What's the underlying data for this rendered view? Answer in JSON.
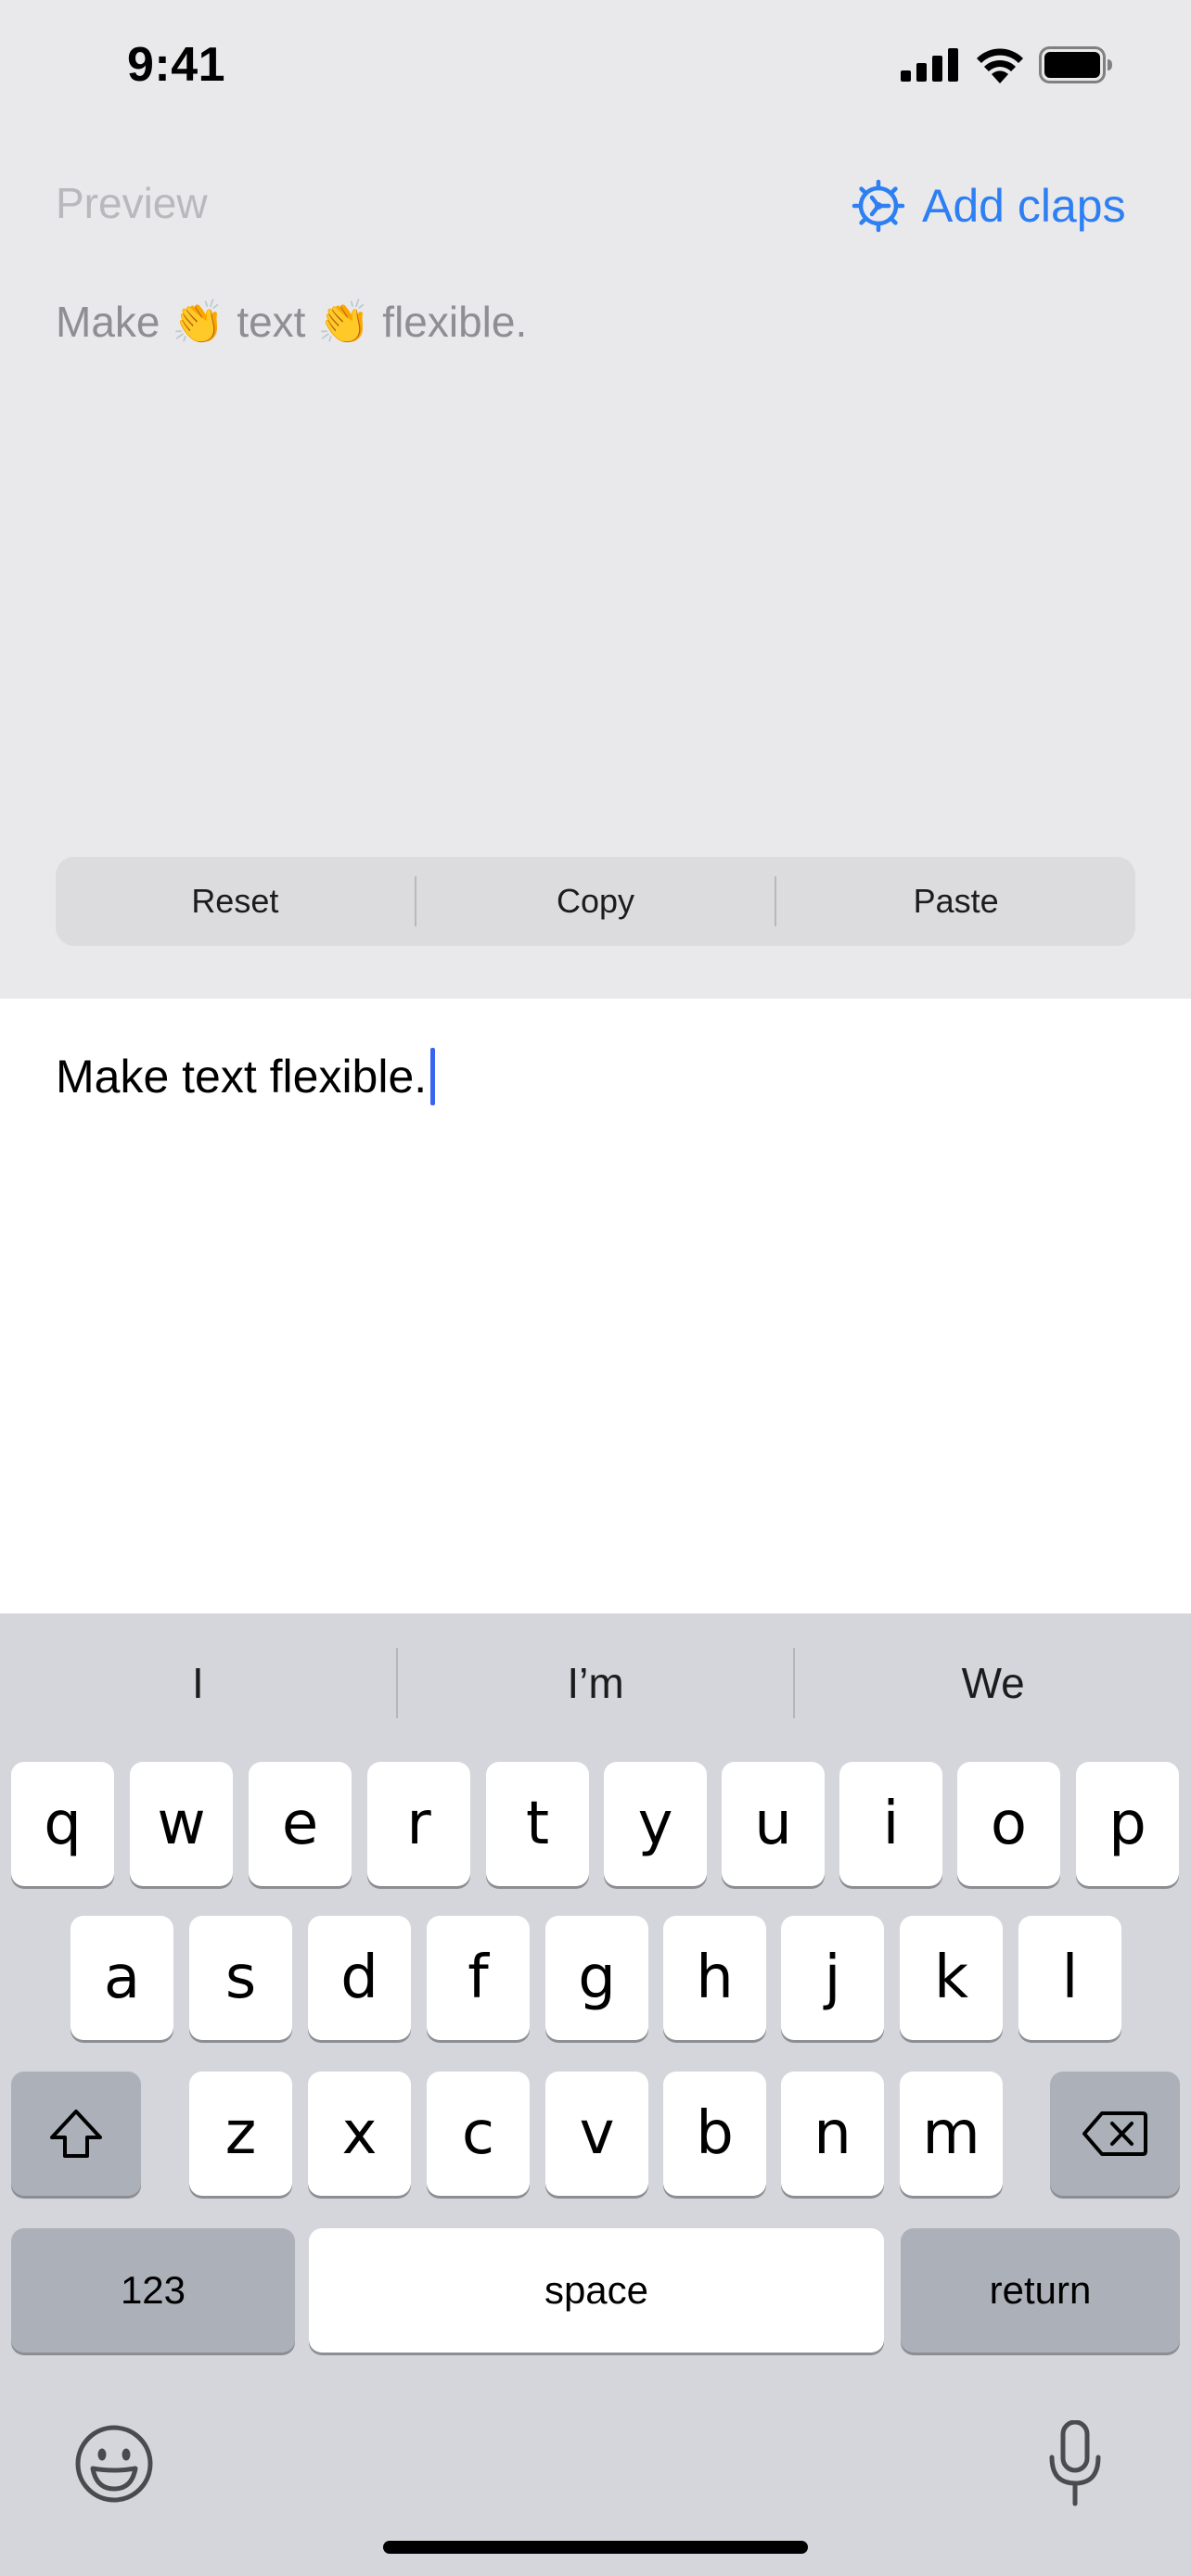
{
  "status_bar": {
    "time": "9:41"
  },
  "header": {
    "preview_label": "Preview",
    "add_claps_label": "Add claps",
    "accent_color": "#2d7ff3"
  },
  "preview": {
    "text": "Make 👏 text 👏 flexible."
  },
  "actions": {
    "reset_label": "Reset",
    "copy_label": "Copy",
    "paste_label": "Paste"
  },
  "editor": {
    "text": "Make text flexible."
  },
  "keyboard": {
    "suggestions": [
      "I",
      "I’m",
      "We"
    ],
    "row1": [
      "q",
      "w",
      "e",
      "r",
      "t",
      "y",
      "u",
      "i",
      "o",
      "p"
    ],
    "row2": [
      "a",
      "s",
      "d",
      "f",
      "g",
      "h",
      "j",
      "k",
      "l"
    ],
    "row3": [
      "z",
      "x",
      "c",
      "v",
      "b",
      "n",
      "m"
    ],
    "numbers_label": "123",
    "space_label": "space",
    "return_label": "return"
  }
}
